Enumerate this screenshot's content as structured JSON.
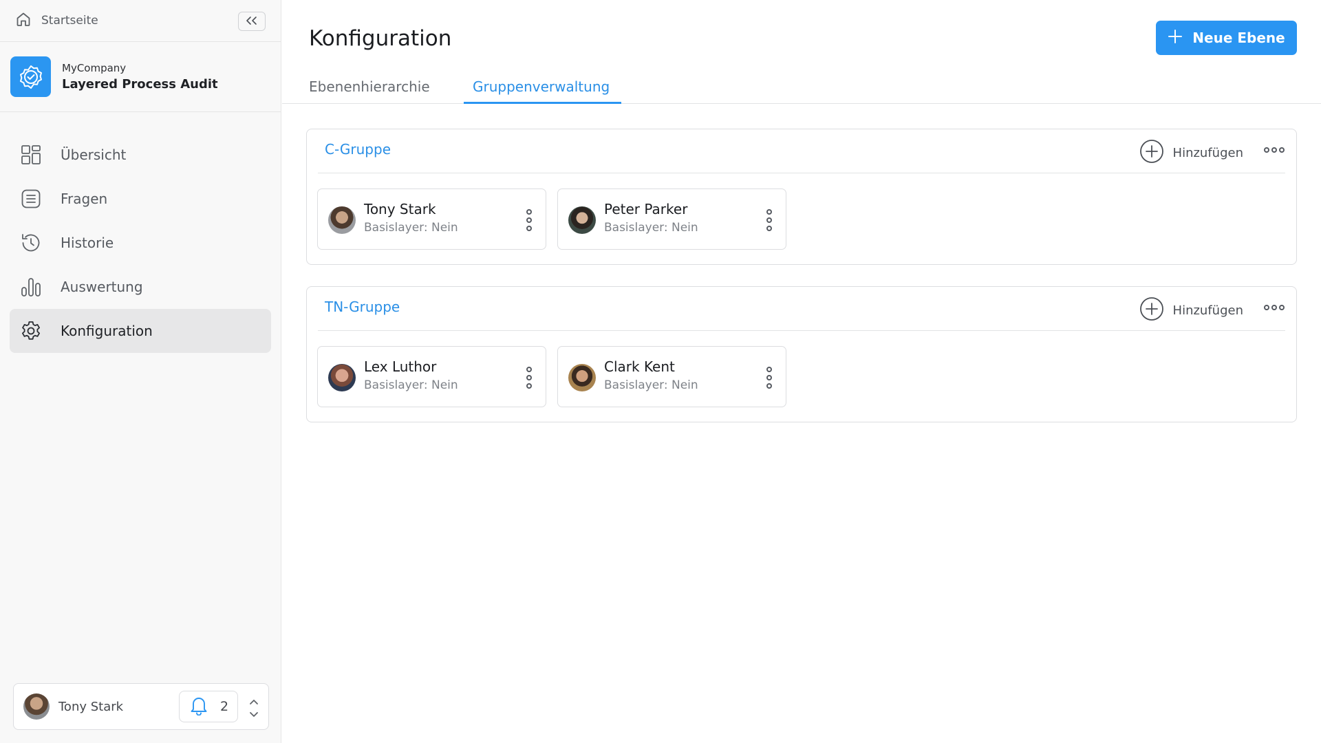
{
  "sidebar": {
    "home_label": "Startseite",
    "brand": {
      "company": "MyCompany",
      "product": "Layered Process Audit"
    },
    "items": [
      {
        "label": "Übersicht",
        "icon": "grid-icon"
      },
      {
        "label": "Fragen",
        "icon": "list-icon"
      },
      {
        "label": "Historie",
        "icon": "history-icon"
      },
      {
        "label": "Auswertung",
        "icon": "bar-chart-icon"
      },
      {
        "label": "Konfiguration",
        "icon": "gear-icon",
        "active": true
      }
    ],
    "user": {
      "name": "Tony Stark",
      "notifications": "2"
    }
  },
  "header": {
    "title": "Konfiguration",
    "primary_button": "Neue Ebene",
    "tabs": [
      {
        "label": "Ebenenhierarchie",
        "active": false
      },
      {
        "label": "Gruppenverwaltung",
        "active": true
      }
    ]
  },
  "groups": [
    {
      "title": "C-Gruppe",
      "add_label": "Hinzufügen",
      "members": [
        {
          "name": "Tony Stark",
          "sub": "Basislayer: Nein"
        },
        {
          "name": "Peter Parker",
          "sub": "Basislayer: Nein"
        }
      ]
    },
    {
      "title": "TN-Gruppe",
      "add_label": "Hinzufügen",
      "members": [
        {
          "name": "Lex Luthor",
          "sub": "Basislayer: Nein"
        },
        {
          "name": "Clark Kent",
          "sub": "Basislayer: Nein"
        }
      ]
    }
  ],
  "colors": {
    "accent": "#2a95f2",
    "accent_text": "#2a8fe6",
    "sidebar_bg": "#f8f8f8",
    "active_nav_bg": "#e7e7e8"
  }
}
